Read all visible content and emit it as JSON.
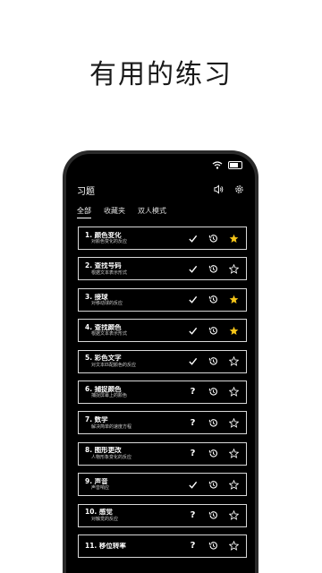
{
  "heading": "有用的练习",
  "app": {
    "title": "习题",
    "tabs": [
      {
        "label": "全部",
        "active": true
      },
      {
        "label": "收藏夹",
        "active": false
      },
      {
        "label": "双人模式",
        "active": false
      }
    ]
  },
  "exercises": [
    {
      "title": "1. 颜色变化",
      "subtitle": "对颜色变化的反应",
      "status": "check",
      "favorite": true
    },
    {
      "title": "2. 查找号码",
      "subtitle": "根据文本表示形式",
      "status": "check",
      "favorite": false
    },
    {
      "title": "3. 接球",
      "subtitle": "对移动球的反应",
      "status": "check",
      "favorite": true
    },
    {
      "title": "4. 查找颜色",
      "subtitle": "根据文本表示形式",
      "status": "check",
      "favorite": true
    },
    {
      "title": "5. 彩色文字",
      "subtitle": "对文本匹配颜色的反应",
      "status": "check",
      "favorite": false
    },
    {
      "title": "6. 捕捉颜色",
      "subtitle": "捕捉屏幕上的颜色",
      "status": "unknown",
      "favorite": false
    },
    {
      "title": "7. 数学",
      "subtitle": "解决简单的速度方程",
      "status": "unknown",
      "favorite": false
    },
    {
      "title": "8. 图形更改",
      "subtitle": "人物形象变化的反应",
      "status": "unknown",
      "favorite": false
    },
    {
      "title": "9. 声音",
      "subtitle": "声音响应",
      "status": "check",
      "favorite": false
    },
    {
      "title": "10. 感觉",
      "subtitle": "对触觉的反应",
      "status": "unknown",
      "favorite": false
    },
    {
      "title": "11. 移位转率",
      "subtitle": "",
      "status": "unknown",
      "favorite": false
    }
  ],
  "colors": {
    "star": "#f5c518",
    "background": "#000000",
    "border": "#d8d8d8"
  }
}
